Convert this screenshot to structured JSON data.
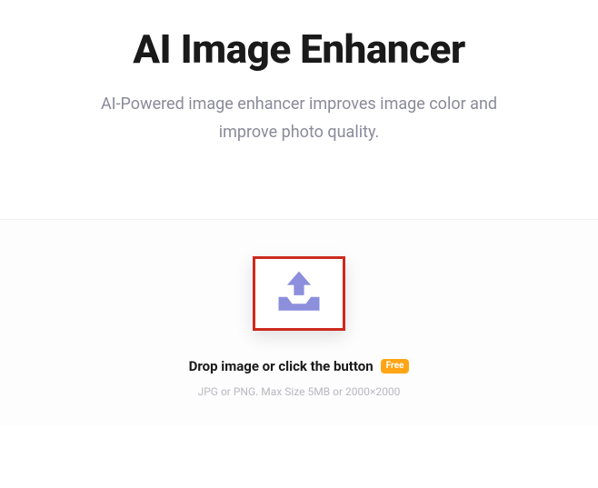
{
  "hero": {
    "title": "AI Image Enhancer",
    "subtitle": "AI-Powered image enhancer improves image color and improve photo quality."
  },
  "upload": {
    "drop_text": "Drop image or click the button",
    "badge": "Free",
    "hint": "JPG or PNG. Max Size 5MB or 2000×2000"
  }
}
